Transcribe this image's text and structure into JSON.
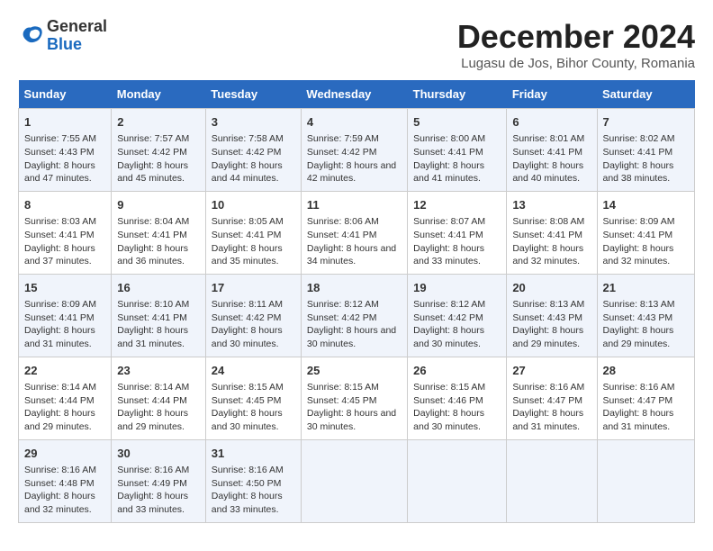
{
  "logo": {
    "general": "General",
    "blue": "Blue"
  },
  "title": "December 2024",
  "location": "Lugasu de Jos, Bihor County, Romania",
  "days_of_week": [
    "Sunday",
    "Monday",
    "Tuesday",
    "Wednesday",
    "Thursday",
    "Friday",
    "Saturday"
  ],
  "weeks": [
    [
      {
        "day": "1",
        "sunrise": "7:55 AM",
        "sunset": "4:43 PM",
        "daylight": "8 hours and 47 minutes."
      },
      {
        "day": "2",
        "sunrise": "7:57 AM",
        "sunset": "4:42 PM",
        "daylight": "8 hours and 45 minutes."
      },
      {
        "day": "3",
        "sunrise": "7:58 AM",
        "sunset": "4:42 PM",
        "daylight": "8 hours and 44 minutes."
      },
      {
        "day": "4",
        "sunrise": "7:59 AM",
        "sunset": "4:42 PM",
        "daylight": "8 hours and 42 minutes."
      },
      {
        "day": "5",
        "sunrise": "8:00 AM",
        "sunset": "4:41 PM",
        "daylight": "8 hours and 41 minutes."
      },
      {
        "day": "6",
        "sunrise": "8:01 AM",
        "sunset": "4:41 PM",
        "daylight": "8 hours and 40 minutes."
      },
      {
        "day": "7",
        "sunrise": "8:02 AM",
        "sunset": "4:41 PM",
        "daylight": "8 hours and 38 minutes."
      }
    ],
    [
      {
        "day": "8",
        "sunrise": "8:03 AM",
        "sunset": "4:41 PM",
        "daylight": "8 hours and 37 minutes."
      },
      {
        "day": "9",
        "sunrise": "8:04 AM",
        "sunset": "4:41 PM",
        "daylight": "8 hours and 36 minutes."
      },
      {
        "day": "10",
        "sunrise": "8:05 AM",
        "sunset": "4:41 PM",
        "daylight": "8 hours and 35 minutes."
      },
      {
        "day": "11",
        "sunrise": "8:06 AM",
        "sunset": "4:41 PM",
        "daylight": "8 hours and 34 minutes."
      },
      {
        "day": "12",
        "sunrise": "8:07 AM",
        "sunset": "4:41 PM",
        "daylight": "8 hours and 33 minutes."
      },
      {
        "day": "13",
        "sunrise": "8:08 AM",
        "sunset": "4:41 PM",
        "daylight": "8 hours and 32 minutes."
      },
      {
        "day": "14",
        "sunrise": "8:09 AM",
        "sunset": "4:41 PM",
        "daylight": "8 hours and 32 minutes."
      }
    ],
    [
      {
        "day": "15",
        "sunrise": "8:09 AM",
        "sunset": "4:41 PM",
        "daylight": "8 hours and 31 minutes."
      },
      {
        "day": "16",
        "sunrise": "8:10 AM",
        "sunset": "4:41 PM",
        "daylight": "8 hours and 31 minutes."
      },
      {
        "day": "17",
        "sunrise": "8:11 AM",
        "sunset": "4:42 PM",
        "daylight": "8 hours and 30 minutes."
      },
      {
        "day": "18",
        "sunrise": "8:12 AM",
        "sunset": "4:42 PM",
        "daylight": "8 hours and 30 minutes."
      },
      {
        "day": "19",
        "sunrise": "8:12 AM",
        "sunset": "4:42 PM",
        "daylight": "8 hours and 30 minutes."
      },
      {
        "day": "20",
        "sunrise": "8:13 AM",
        "sunset": "4:43 PM",
        "daylight": "8 hours and 29 minutes."
      },
      {
        "day": "21",
        "sunrise": "8:13 AM",
        "sunset": "4:43 PM",
        "daylight": "8 hours and 29 minutes."
      }
    ],
    [
      {
        "day": "22",
        "sunrise": "8:14 AM",
        "sunset": "4:44 PM",
        "daylight": "8 hours and 29 minutes."
      },
      {
        "day": "23",
        "sunrise": "8:14 AM",
        "sunset": "4:44 PM",
        "daylight": "8 hours and 29 minutes."
      },
      {
        "day": "24",
        "sunrise": "8:15 AM",
        "sunset": "4:45 PM",
        "daylight": "8 hours and 30 minutes."
      },
      {
        "day": "25",
        "sunrise": "8:15 AM",
        "sunset": "4:45 PM",
        "daylight": "8 hours and 30 minutes."
      },
      {
        "day": "26",
        "sunrise": "8:15 AM",
        "sunset": "4:46 PM",
        "daylight": "8 hours and 30 minutes."
      },
      {
        "day": "27",
        "sunrise": "8:16 AM",
        "sunset": "4:47 PM",
        "daylight": "8 hours and 31 minutes."
      },
      {
        "day": "28",
        "sunrise": "8:16 AM",
        "sunset": "4:47 PM",
        "daylight": "8 hours and 31 minutes."
      }
    ],
    [
      {
        "day": "29",
        "sunrise": "8:16 AM",
        "sunset": "4:48 PM",
        "daylight": "8 hours and 32 minutes."
      },
      {
        "day": "30",
        "sunrise": "8:16 AM",
        "sunset": "4:49 PM",
        "daylight": "8 hours and 33 minutes."
      },
      {
        "day": "31",
        "sunrise": "8:16 AM",
        "sunset": "4:50 PM",
        "daylight": "8 hours and 33 minutes."
      },
      null,
      null,
      null,
      null
    ]
  ],
  "labels": {
    "sunrise": "Sunrise:",
    "sunset": "Sunset:",
    "daylight": "Daylight:"
  }
}
